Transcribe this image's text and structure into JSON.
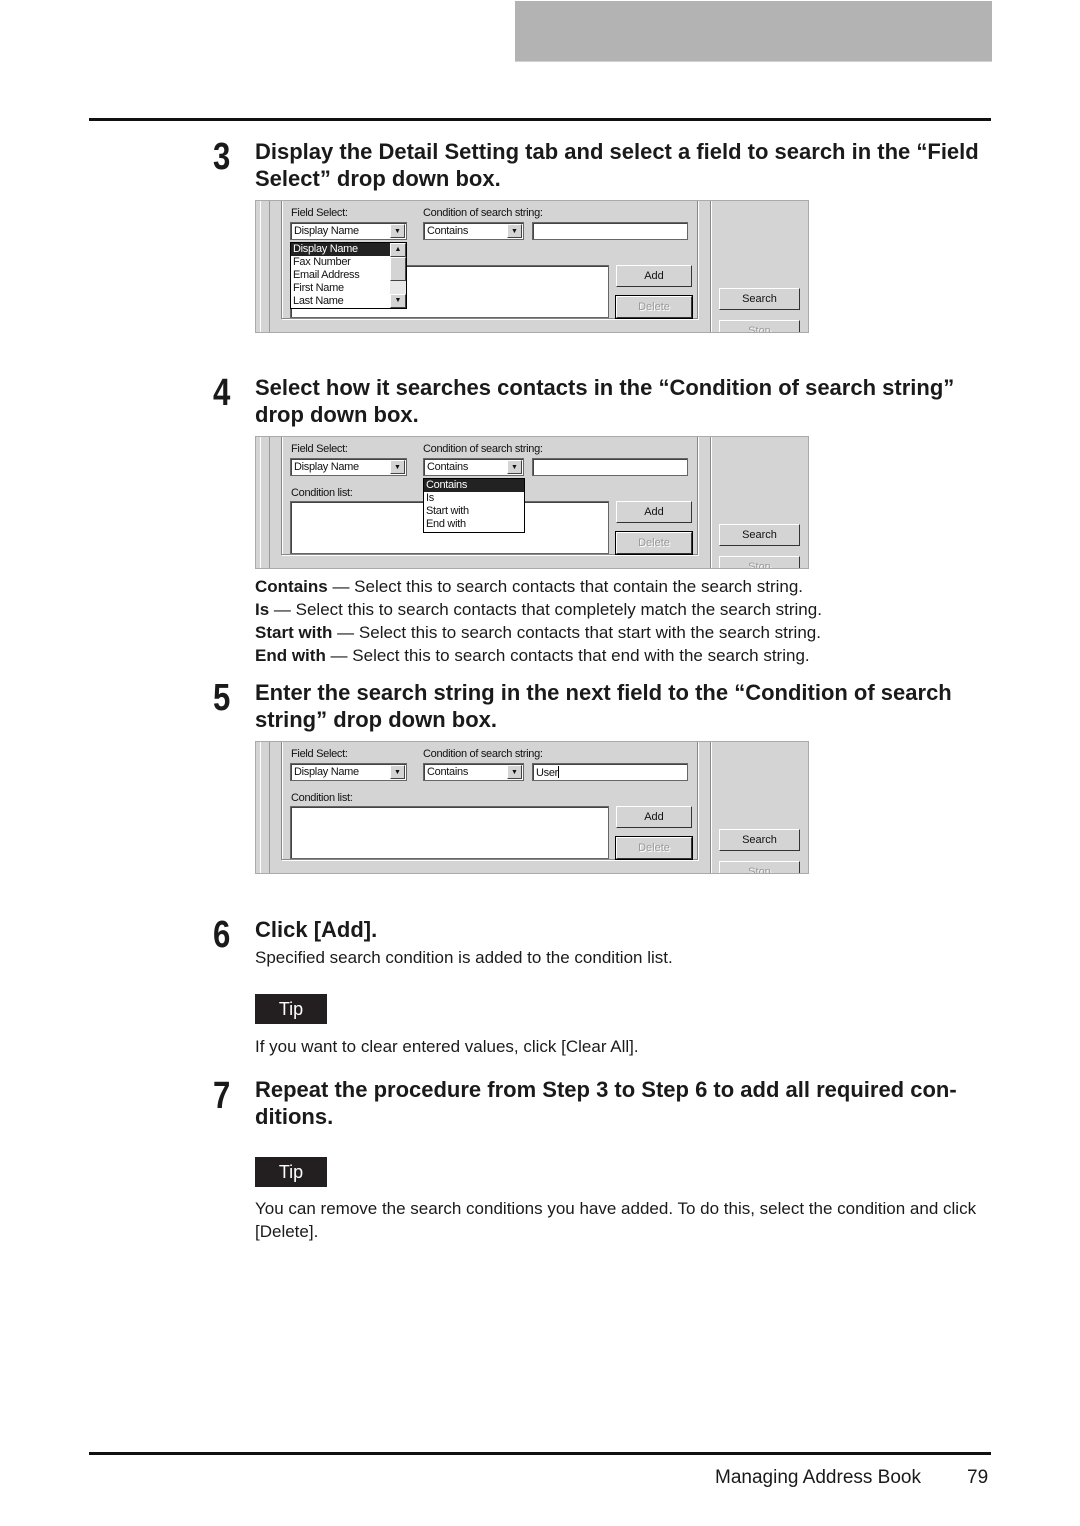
{
  "footer": {
    "section": "Managing Address Book",
    "page": "79"
  },
  "ui": {
    "field_select_label": "Field Select:",
    "condition_label": "Condition of search string:",
    "condition_list_label": "Condition list:",
    "field_value": "Display Name",
    "condition_value": "Contains",
    "add_button": "Add",
    "delete_button": "Delete",
    "search_button": "Search",
    "stop_button": "Stop",
    "field_options": [
      "Display Name",
      "Fax Number",
      "Email Address",
      "First Name",
      "Last Name"
    ],
    "condition_options": [
      "Contains",
      "Is",
      "Start with",
      "End with"
    ],
    "search_string_entered": "User"
  },
  "steps": [
    {
      "number": "3",
      "title": "Display the Detail Setting tab and select a field to search in the “Field Select” drop down box."
    },
    {
      "number": "4",
      "title": "Select how it searches contacts in the “Condition of search string” drop down box.",
      "definitions": [
        {
          "term": "Contains",
          "text": " — Select this to search contacts that contain the search string."
        },
        {
          "term": "Is",
          "text": " — Select this to search contacts that completely match the search string."
        },
        {
          "term": "Start with",
          "text": " — Select this to search contacts that start with the search string."
        },
        {
          "term": "End with",
          "text": " — Select this to search contacts that end with the search string."
        }
      ]
    },
    {
      "number": "5",
      "title": "Enter the search string in the next field to the “Condition of search string” drop down box."
    },
    {
      "number": "6",
      "title": "Click [Add].",
      "body": "Specified search condition is added to the condition list.",
      "tip_label": "Tip",
      "tip": "If you want to clear entered values, click [Clear All]."
    },
    {
      "number": "7",
      "title": "Repeat the procedure from Step 3 to Step 6 to add all required con-ditions.",
      "title_line1": "Repeat the procedure from Step 3 to Step 6 to add all required con-",
      "title_line2": "ditions.",
      "tip_label": "Tip",
      "tip": "You can remove the search conditions you have added. To do this, select the condition and click [Delete]."
    }
  ]
}
